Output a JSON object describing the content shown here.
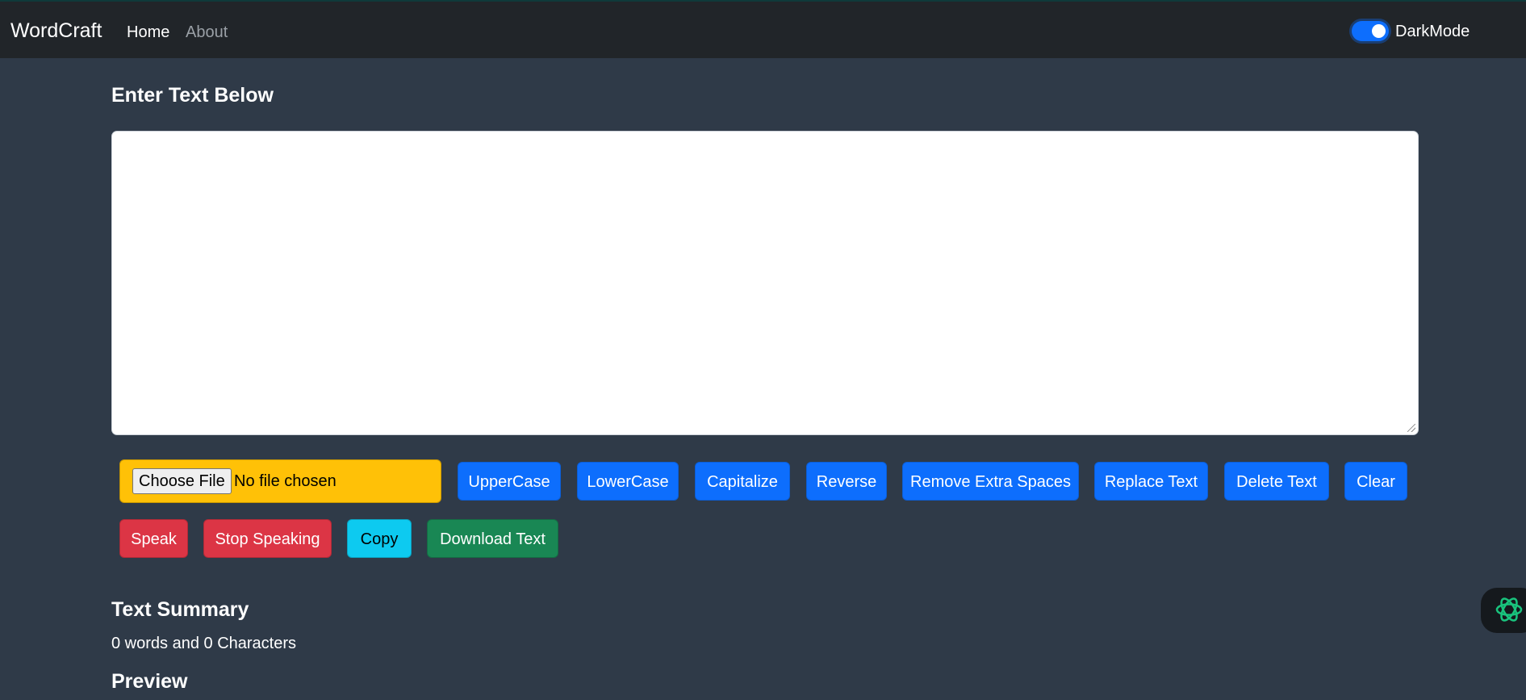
{
  "nav": {
    "brand": "WordCraft",
    "links": [
      "Home",
      "About"
    ],
    "dark_mode_label": "DarkMode",
    "dark_mode_on": true
  },
  "main": {
    "heading": "Enter Text Below",
    "textarea_value": "",
    "file_input": {
      "button_label": "Choose File",
      "status": "No file chosen"
    },
    "actions_row1": [
      "UpperCase",
      "LowerCase",
      "Capitalize",
      "Reverse",
      "Remove Extra Spaces",
      "Replace Text",
      "Delete Text",
      "Clear"
    ],
    "actions_row2": [
      "Speak",
      "Stop Speaking",
      "Copy",
      "Download Text"
    ]
  },
  "summary": {
    "heading": "Text Summary",
    "text": "0 words and 0 Characters"
  },
  "preview": {
    "heading": "Preview"
  },
  "colors": {
    "background": "#2f3a48",
    "navbar": "#212529",
    "primary": "#0d6efd",
    "danger": "#dc3545",
    "info": "#0dcaf0",
    "success": "#198754",
    "warning": "#ffc107"
  },
  "icons": {
    "assistant": "chatgpt-assistant-icon"
  }
}
